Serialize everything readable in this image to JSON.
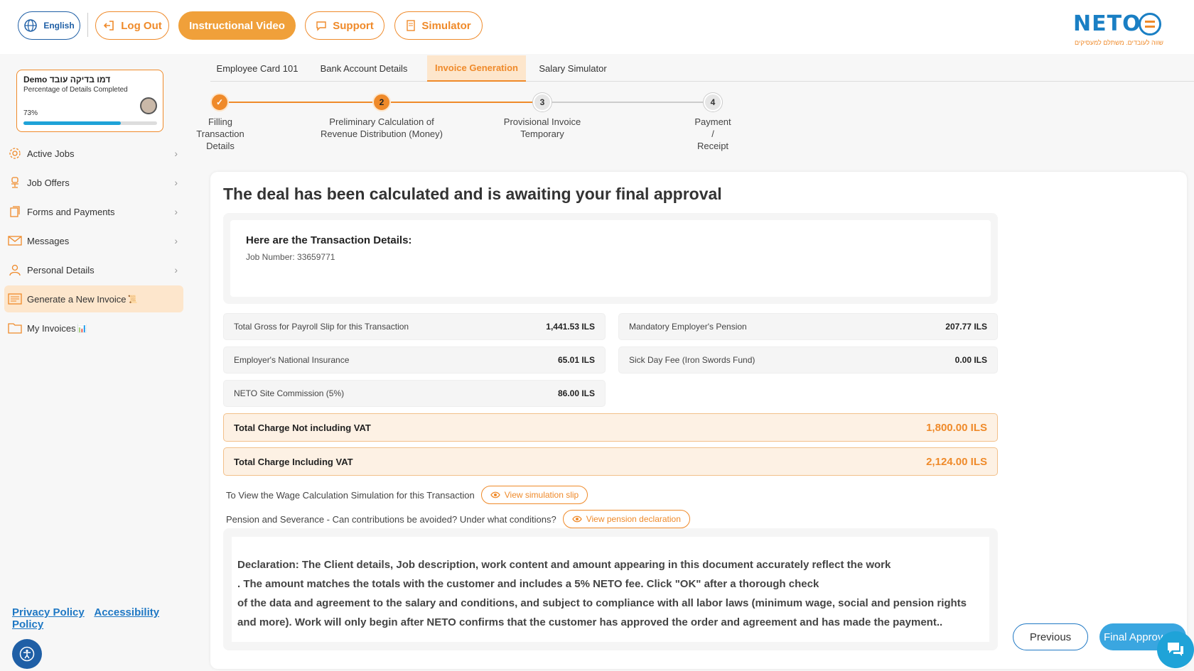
{
  "header": {
    "language_label": "English",
    "logout_label": "Log Out",
    "video_label": "Instructional Video",
    "support_label": "Support",
    "simulator_label": "Simulator",
    "logo_text": "NETO",
    "logo_tagline": "שווה לעובדים. משתלם למעסיקים"
  },
  "profile": {
    "name": "Demo דמו בדיקה עובד",
    "subtitle": "Percentage of Details Completed",
    "percent_label": "73%",
    "percent": 73
  },
  "sidebar": {
    "items": [
      {
        "label": "Active Jobs"
      },
      {
        "label": "Job Offers"
      },
      {
        "label": "Forms and Payments"
      },
      {
        "label": "Messages"
      },
      {
        "label": "Personal Details"
      },
      {
        "label": "Generate a New Invoice"
      },
      {
        "label": "My Invoices"
      }
    ],
    "privacy_label": "Privacy Policy",
    "accessibility_label": "Accessibility Policy"
  },
  "tabs": [
    {
      "label": "Employee Card 101"
    },
    {
      "label": "Bank Account Details"
    },
    {
      "label": "Invoice Generation"
    },
    {
      "label": "Salary Simulator"
    }
  ],
  "stepper": {
    "steps": [
      {
        "number": "✓",
        "label_lines": [
          "Filling",
          "Transaction",
          "Details"
        ]
      },
      {
        "number": "2",
        "label_lines": [
          "Preliminary Calculation of",
          "Revenue Distribution (Money)"
        ]
      },
      {
        "number": "3",
        "label_lines": [
          "Provisional Invoice",
          "Temporary"
        ]
      },
      {
        "number": "4",
        "label_lines": [
          "Payment",
          "/",
          "Receipt"
        ]
      }
    ]
  },
  "main": {
    "title": "The deal has been calculated and is awaiting your final approval",
    "details_title": "Here are the Transaction Details:",
    "job_number": "Job Number: 33659771",
    "rows": [
      {
        "label": "Total Gross for Payroll Slip for this Transaction",
        "value": "1,441.53 ILS"
      },
      {
        "label": "Mandatory Employer's Pension",
        "value": "207.77 ILS"
      },
      {
        "label": "Employer's National Insurance",
        "value": "65.01 ILS"
      },
      {
        "label": "Sick Day Fee (Iron Swords Fund)",
        "value": "0.00 ILS"
      },
      {
        "label": "NETO Site Commission (5%)",
        "value": "86.00 ILS"
      }
    ],
    "total_no_vat_label": "Total Charge Not including VAT",
    "total_no_vat_value": "1,800.00 ILS",
    "total_vat_label": "Total Charge Including VAT",
    "total_vat_value": "2,124.00 ILS",
    "sim_text": "To View the Wage Calculation Simulation for this Transaction",
    "sim_button": "View simulation slip",
    "pension_text": "Pension and Severance - Can contributions be avoided? Under what conditions?",
    "pension_button": "View pension declaration",
    "declaration_lines": [
      "Declaration: The Client details, Job description, work content and amount appearing in this document accurately reflect the work",
      ". The amount matches the totals with the customer and includes a 5% NETO fee. Click \"OK\" after a thorough check",
      "of the data and agreement to the salary and conditions, and subject to compliance with all labor laws (minimum wage, social and pension rights",
      "and more). Work will only begin after NETO confirms that the customer has approved the order and agreement and has made the payment.."
    ],
    "previous_label": "Previous",
    "final_label": "Final Approval"
  },
  "colors": {
    "accent": "#ef8a2a",
    "accent_light": "#fde6cc",
    "brand_blue": "#1f78c4",
    "progress": "#1fa3d8"
  }
}
